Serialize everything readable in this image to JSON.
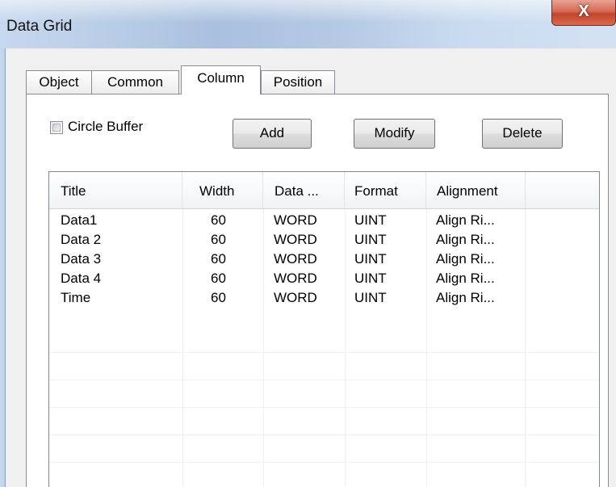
{
  "window": {
    "title": "Data Grid",
    "close_glyph": "X"
  },
  "tabs": [
    {
      "label": "Object",
      "active": false
    },
    {
      "label": "Common",
      "active": false
    },
    {
      "label": "Column",
      "active": true
    },
    {
      "label": "Position",
      "active": false
    }
  ],
  "options": {
    "circle_buffer_label": "Circle Buffer",
    "circle_buffer_checked": false
  },
  "buttons": {
    "add": "Add",
    "modify": "Modify",
    "delete": "Delete"
  },
  "grid": {
    "columns": [
      "Title",
      "Width",
      "Data ...",
      "Format",
      "Alignment"
    ],
    "rows": [
      {
        "title": "Data1",
        "width": "60",
        "data": "WORD",
        "format": "UINT",
        "alignment": "Align Ri..."
      },
      {
        "title": "Data 2",
        "width": "60",
        "data": "WORD",
        "format": "UINT",
        "alignment": "Align Ri..."
      },
      {
        "title": "Data 3",
        "width": "60",
        "data": "WORD",
        "format": "UINT",
        "alignment": "Align Ri..."
      },
      {
        "title": "Data 4",
        "width": "60",
        "data": "WORD",
        "format": "UINT",
        "alignment": "Align Ri..."
      },
      {
        "title": "Time",
        "width": "60",
        "data": "WORD",
        "format": "UINT",
        "alignment": "Align Ri..."
      }
    ]
  },
  "colors": {
    "close_button": "#c2452c",
    "panel_background": "#ffffff",
    "window_background": "#f0f0f0"
  }
}
